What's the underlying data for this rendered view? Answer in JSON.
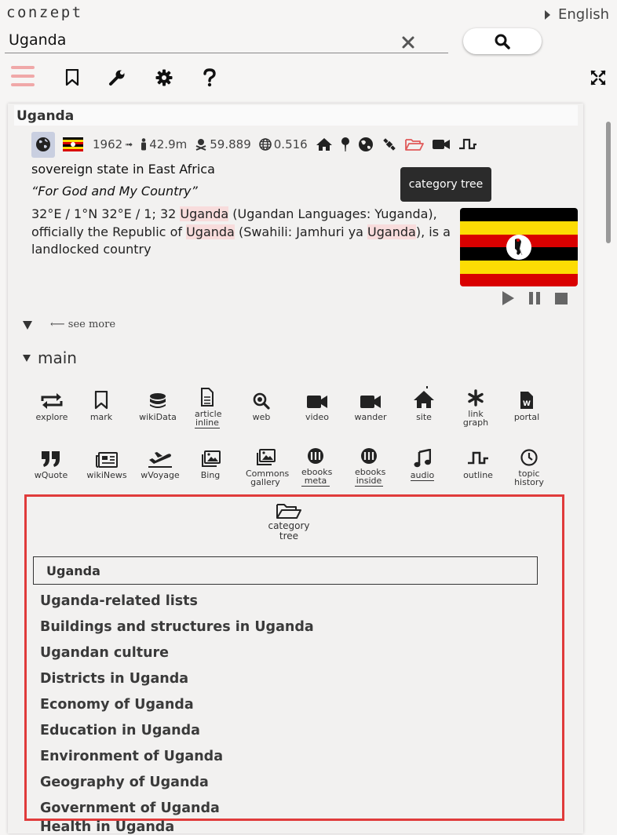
{
  "app": {
    "logo": "conzept",
    "language": "English"
  },
  "search": {
    "value": "Uganda"
  },
  "article": {
    "title": "Uganda",
    "meta": {
      "year": "1962",
      "population": "42.9m",
      "deaths": "59.889",
      "hdi": "0.516"
    },
    "description": "sovereign state in East Africa",
    "motto": "“For God and My Country”",
    "body": {
      "p1": "32°E / 1°N 32°E / 1; 32 ",
      "h1": "Uganda",
      "p2": " (Ugandan Languages: Yuganda), officially the Republic of ",
      "h2": "Uganda",
      "p3": " (Swahili: Jamhuri ya ",
      "h3": "Uganda",
      "p4": "), is a landlocked country"
    },
    "see_more": "see more"
  },
  "tooltip": "category tree",
  "section": {
    "label": "main"
  },
  "tools_row1": [
    {
      "label": "explore"
    },
    {
      "label": "mark"
    },
    {
      "label": "wikiData"
    },
    {
      "label": "article inline"
    },
    {
      "label": "web"
    },
    {
      "label": "video"
    },
    {
      "label": "wander"
    },
    {
      "label": "site"
    },
    {
      "label": "link graph"
    },
    {
      "label": "portal"
    }
  ],
  "tools_row2": [
    {
      "label": "wQuote"
    },
    {
      "label": "wikiNews"
    },
    {
      "label": "wVoyage"
    },
    {
      "label": "Bing"
    },
    {
      "label": "Commons gallery"
    },
    {
      "label": "ebooks meta"
    },
    {
      "label": "ebooks inside"
    },
    {
      "label": "audio"
    },
    {
      "label": "outline"
    },
    {
      "label": "topic history"
    }
  ],
  "category_tree": {
    "label": "category tree",
    "input_value": "Uganda",
    "items": [
      "Uganda-related lists",
      "Buildings and structures in Uganda",
      "Ugandan culture",
      "Districts in Uganda",
      "Economy of Uganda",
      "Education in Uganda",
      "Environment of Uganda",
      "Geography of Uganda",
      "Government of Uganda"
    ],
    "overflow_item": "Health in Uganda"
  },
  "colors": {
    "accent": "#e03b3b",
    "hamburger": "#f0a8a8",
    "tooltip_bg": "#2b2b2b",
    "highlight": "#f8dcdc"
  },
  "icons": [
    "hamburger-icon",
    "bookmark-icon",
    "wrench-icon",
    "gear-icon",
    "help-icon",
    "fullscreen-icon",
    "search-icon",
    "close-icon"
  ]
}
